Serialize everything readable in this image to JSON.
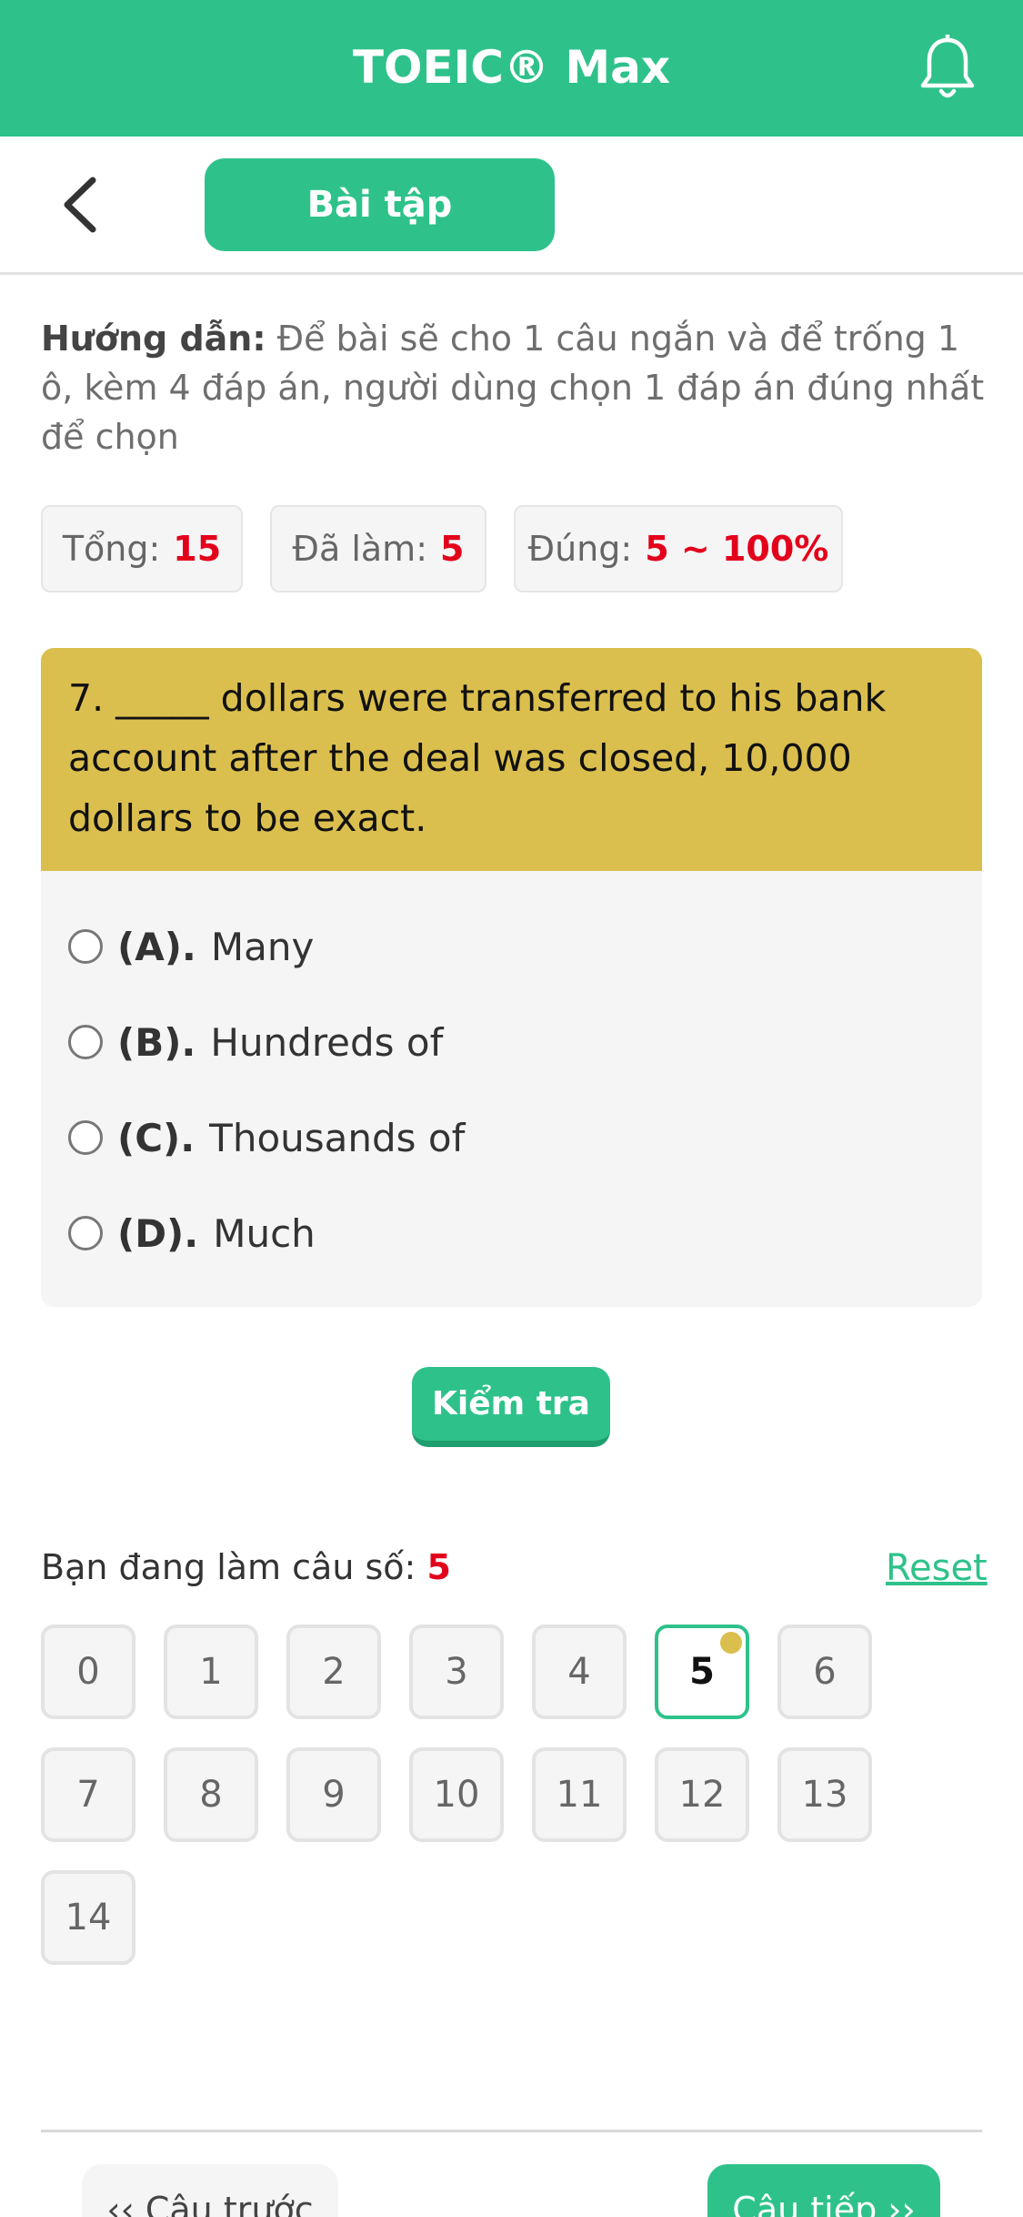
{
  "app": {
    "title": "TOEIC® Max",
    "icons": {
      "notifications": "bell-icon",
      "back": "chevron-left-icon"
    }
  },
  "nav": {
    "tab_label": "Bài tập"
  },
  "guide": {
    "label": "Hướng dẫn:",
    "text": " Để bài sẽ cho 1 câu ngắn và để trống 1 ô, kèm 4 đáp án, người dùng chọn 1 đáp án đúng nhất để chọn"
  },
  "stats": {
    "total_label": "Tổng:",
    "total_value": "15",
    "done_label": "Đã làm:",
    "done_value": "5",
    "correct_label": "Đúng:",
    "correct_value": "5 ~ 100%"
  },
  "question": {
    "text": "7. _____ dollars were transferred to his bank account after the deal was closed, 10,000 dollars to be exact.",
    "options": [
      {
        "key": "(A).",
        "text": "Many"
      },
      {
        "key": "(B).",
        "text": "Hundreds of"
      },
      {
        "key": "(C).",
        "text": "Thousands of"
      },
      {
        "key": "(D).",
        "text": "Much"
      }
    ],
    "check_label": "Kiểm tra"
  },
  "progress": {
    "current_label": "Bạn đang làm câu số:",
    "current_value": "5",
    "reset_label": "Reset",
    "numbers": [
      "0",
      "1",
      "2",
      "3",
      "4",
      "5",
      "6",
      "7",
      "8",
      "9",
      "10",
      "11",
      "12",
      "13",
      "14"
    ],
    "active_index": 5
  },
  "footer": {
    "prev_label": "‹‹ Câu trước",
    "next_label": "Câu tiếp ››"
  },
  "colors": {
    "brand": "#2ec28a",
    "question_bg": "#dbbf4e",
    "highlight": "#e3001b"
  }
}
